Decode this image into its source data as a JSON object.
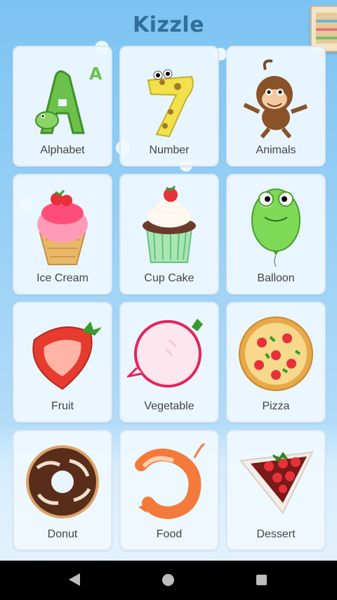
{
  "app": {
    "title": "Kizzle"
  },
  "categories": [
    {
      "label": "Alphabet",
      "icon": "alphabet-icon"
    },
    {
      "label": "Number",
      "icon": "number-icon"
    },
    {
      "label": "Animals",
      "icon": "monkey-icon"
    },
    {
      "label": "Ice Cream",
      "icon": "ice-cream-icon"
    },
    {
      "label": "Cup Cake",
      "icon": "cupcake-icon"
    },
    {
      "label": "Balloon",
      "icon": "balloon-icon"
    },
    {
      "label": "Fruit",
      "icon": "strawberry-icon"
    },
    {
      "label": "Vegetable",
      "icon": "radish-icon"
    },
    {
      "label": "Pizza",
      "icon": "pizza-icon"
    },
    {
      "label": "Donut",
      "icon": "donut-icon"
    },
    {
      "label": "Food",
      "icon": "shrimp-icon"
    },
    {
      "label": "Dessert",
      "icon": "cake-slice-icon"
    }
  ],
  "navbar": {
    "back_icon": "back-icon",
    "home_icon": "home-icon",
    "recent_icon": "recent-apps-icon"
  }
}
